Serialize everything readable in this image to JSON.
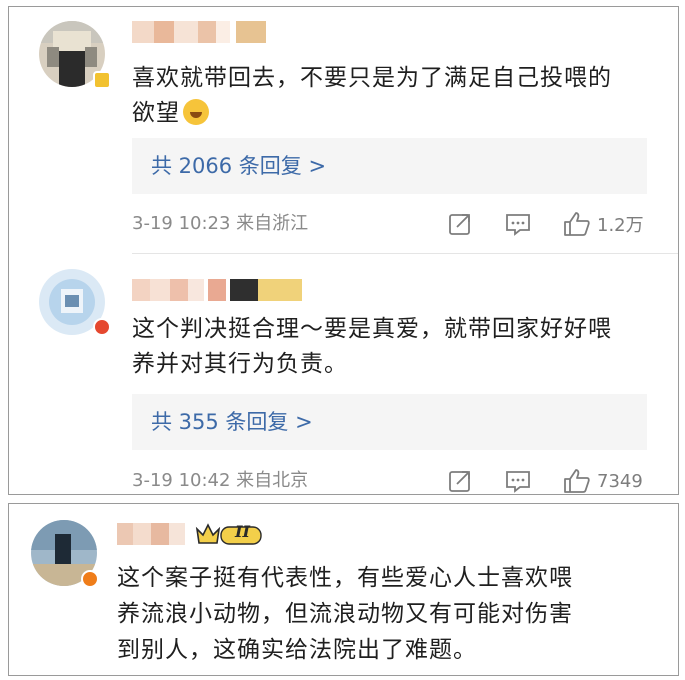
{
  "comments": [
    {
      "text_line1": "喜欢就带回去，不要只是为了满足自己投喂的",
      "text_line2": "欲望",
      "emoji_icon": "laugh-cry-icon",
      "replies_label": "共 2066 条回复 >",
      "time_location": "3-19 10:23  来自浙江",
      "like_count": "1.2万"
    },
    {
      "text_line1": "这个判决挺合理～要是真爱，就带回家好好喂",
      "text_line2": "养并对其行为负责。",
      "replies_label": "共 355 条回复 >",
      "time_location": "3-19 10:42  来自北京",
      "like_count": "7349"
    },
    {
      "text_line1": "这个案子挺有代表性，有些爱心人士喜欢喂",
      "text_line2": "养流浪小动物，但流浪动物又有可能对伤害",
      "text_line3": "到别人，这确实给法院出了难题。",
      "vip_badge": "II"
    }
  ],
  "icons": {
    "share": "share-icon",
    "comment": "comment-icon",
    "like": "thumbs-up-icon"
  },
  "colors": {
    "link_blue": "#3d6aa8",
    "meta_gray": "#8a8a8a",
    "reply_bg": "#f5f5f5",
    "vip_gold": "#e4b43a"
  }
}
